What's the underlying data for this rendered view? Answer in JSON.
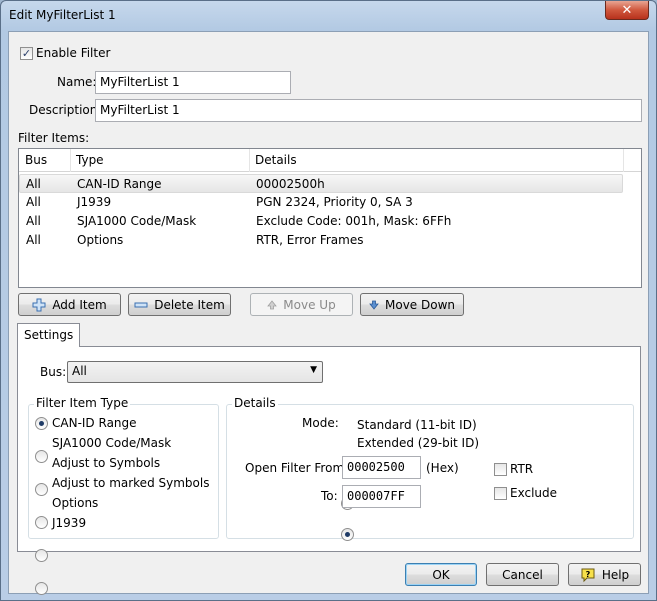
{
  "window": {
    "title": "Edit MyFilterList 1",
    "close_glyph": "✕"
  },
  "form": {
    "enable_filter": {
      "label": "Enable Filter",
      "checked": true
    },
    "name": {
      "label": "Name:",
      "value": "MyFilterList 1"
    },
    "description": {
      "label": "Description:",
      "value": "MyFilterList 1"
    },
    "filter_items_label": "Filter Items:"
  },
  "list": {
    "columns": [
      "Bus",
      "Type",
      "Details"
    ],
    "rows": [
      {
        "bus": "All",
        "type": "CAN-ID Range",
        "details": "00002500h",
        "selected": true
      },
      {
        "bus": "All",
        "type": "J1939",
        "details": "PGN 2324, Priority 0, SA 3",
        "selected": false
      },
      {
        "bus": "All",
        "type": "SJA1000 Code/Mask",
        "details": "Exclude Code: 001h, Mask: 6FFh",
        "selected": false
      },
      {
        "bus": "All",
        "type": "Options",
        "details": "RTR, Error Frames",
        "selected": false
      }
    ]
  },
  "list_buttons": {
    "add": {
      "label": "Add Item",
      "icon": "plus-icon"
    },
    "delete": {
      "label": "Delete Item",
      "icon": "minus-icon"
    },
    "move_up": {
      "label": "Move Up",
      "icon": "arrow-up-icon",
      "enabled": false
    },
    "move_down": {
      "label": "Move Down",
      "icon": "arrow-down-icon",
      "enabled": true
    }
  },
  "settings": {
    "tab_label": "Settings",
    "bus": {
      "label": "Bus:",
      "value": "All",
      "icon": "dropdown-arrow-icon"
    },
    "filter_item_type": {
      "title": "Filter Item Type",
      "options": [
        "CAN-ID Range",
        "SJA1000 Code/Mask",
        "Adjust to Symbols",
        "Adjust to marked Symbols",
        "Options",
        "J1939"
      ],
      "selected": "CAN-ID Range"
    },
    "details": {
      "title": "Details",
      "mode_label": "Mode:",
      "modes": [
        "Standard (11-bit ID)",
        "Extended (29-bit ID)"
      ],
      "mode_selected": "Extended (29-bit ID)",
      "from_label": "Open Filter From:",
      "from_value": "00002500",
      "hex_label": "(Hex)",
      "to_label": "To:",
      "to_value": "000007FF",
      "rtr": {
        "label": "RTR",
        "checked": false
      },
      "exclude": {
        "label": "Exclude",
        "checked": false
      }
    }
  },
  "footer": {
    "ok": "OK",
    "cancel": "Cancel",
    "help": "Help",
    "help_icon": "help-question-icon"
  },
  "colors": {
    "title_bar": "#b9cde6",
    "close_red": "#c9442b",
    "selection": "#e8e8e8",
    "default_button_border": "#3c7fb1"
  }
}
